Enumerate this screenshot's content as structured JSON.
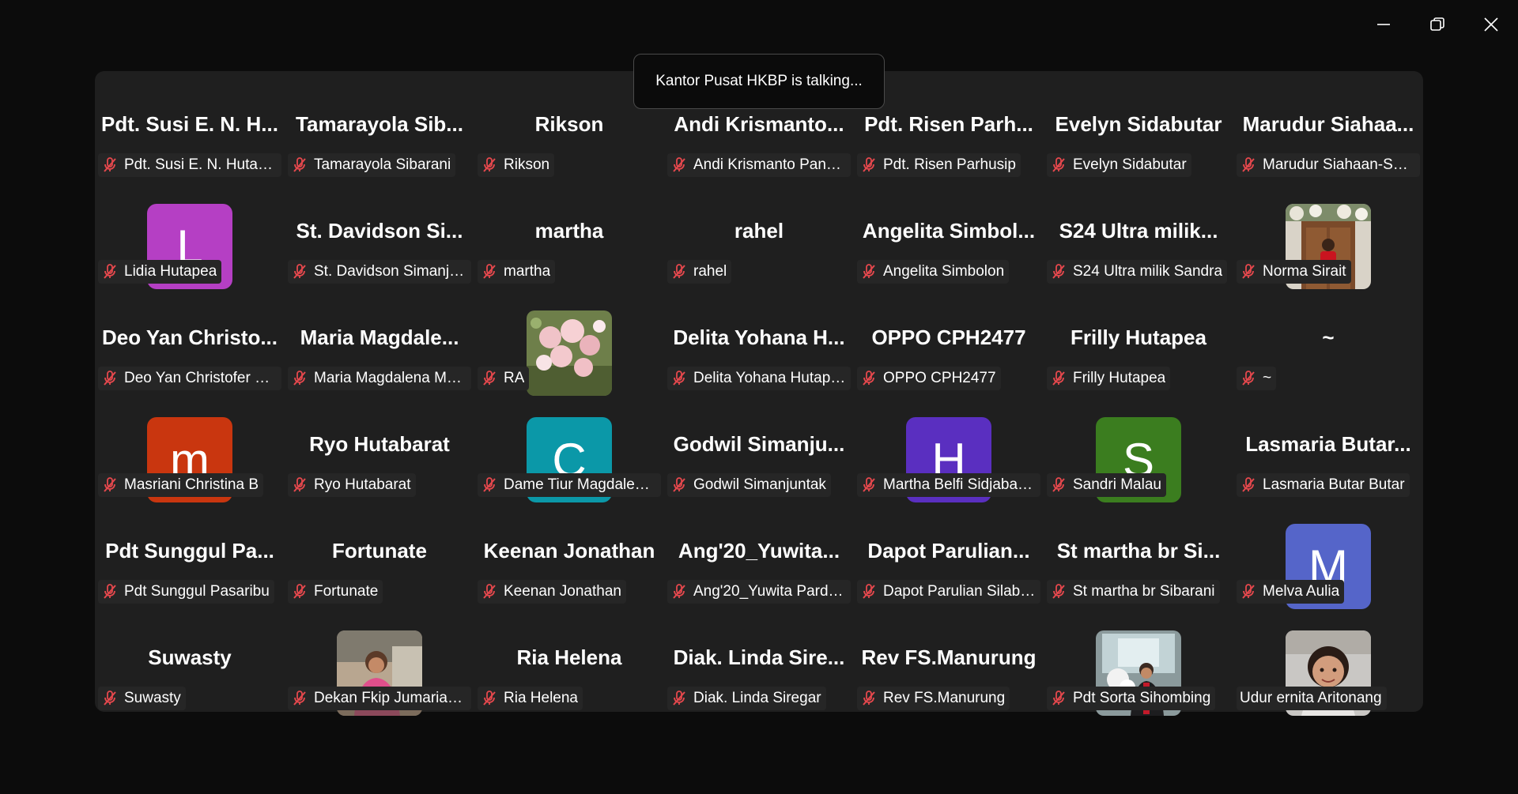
{
  "toast": {
    "text": "Kantor Pusat HKBP is talking..."
  },
  "window_controls": {
    "minimize_icon": "minimize-icon",
    "restore_icon": "restore-icon",
    "close_icon": "close-icon"
  },
  "colors": {
    "mic_muted": "#e5484d",
    "label_bg": "#262626",
    "gallery_bg": "#1f1f1f"
  },
  "participants": [
    {
      "display": "Pdt. Susi E. N. H...",
      "label": "Pdt. Susi E. N. Hutabar...",
      "muted": true
    },
    {
      "display": "Tamarayola  Sib...",
      "label": "Tamarayola Sibarani",
      "muted": true
    },
    {
      "display": "Rikson",
      "label": "Rikson",
      "muted": true
    },
    {
      "display": "Andi Krismanto...",
      "label": "Andi Krismanto Pangg...",
      "muted": true
    },
    {
      "display": "Pdt. Risen Parh...",
      "label": "Pdt. Risen Parhusip",
      "muted": true
    },
    {
      "display": "Evelyn Sidabutar",
      "label": "Evelyn Sidabutar",
      "muted": true
    },
    {
      "display": "Marudur  Siahaa...",
      "label": "Marudur Siahaan-STB ...",
      "muted": true
    },
    {
      "avatar": "L",
      "avatar_color": "#b53fc4",
      "label": "Lidia Hutapea",
      "muted": true
    },
    {
      "display": "St. Davidson Si...",
      "label": "St. Davidson Simanjun...",
      "muted": true
    },
    {
      "display": "martha",
      "label": "martha",
      "muted": true
    },
    {
      "display": "rahel",
      "label": "rahel",
      "muted": true
    },
    {
      "display": "Angelita  Simbol...",
      "label": "Angelita Simbolon",
      "muted": true
    },
    {
      "display": "S24 Ultra milik...",
      "label": "S24 Ultra milik Sandra",
      "muted": true
    },
    {
      "photo": "door-photo",
      "label": "Norma Sirait",
      "muted": true
    },
    {
      "display": "Deo Yan Christo...",
      "label": "Deo Yan Christofer Pa...",
      "muted": true
    },
    {
      "display": "Maria  Magdale...",
      "label": "Maria Magdalena Ma...",
      "muted": true
    },
    {
      "photo": "flowers-photo",
      "label": "RA",
      "muted": true
    },
    {
      "display": "Delita Yohana H...",
      "label": "Delita Yohana Hutapea",
      "muted": true
    },
    {
      "display": "OPPO CPH2477",
      "label": "OPPO CPH2477",
      "muted": true
    },
    {
      "display": "Frilly Hutapea",
      "label": "Frilly Hutapea",
      "muted": true
    },
    {
      "display": "~",
      "label": "~",
      "muted": true
    },
    {
      "avatar": "m",
      "avatar_color": "#c9360f",
      "label": "Masriani Christina B",
      "muted": true
    },
    {
      "display": "Ryo Hutabarat",
      "label": "Ryo Hutabarat",
      "muted": true
    },
    {
      "avatar": "C",
      "avatar_color": "#0b98a8",
      "label": "Dame Tiur Magdalena...",
      "muted": true
    },
    {
      "display": "Godwil  Simanju...",
      "label": "Godwil Simanjuntak",
      "muted": true
    },
    {
      "avatar": "H",
      "avatar_color": "#5a2fc0",
      "label": "Martha Belfi Sidjabat-...",
      "muted": true
    },
    {
      "avatar": "S",
      "avatar_color": "#3b7d1f",
      "label": "Sandri Malau",
      "muted": true
    },
    {
      "display": "Lasmaria  Butar...",
      "label": "Lasmaria Butar Butar",
      "muted": true
    },
    {
      "display": "Pdt Sunggul  Pa...",
      "label": "Pdt Sunggul Pasaribu",
      "muted": true
    },
    {
      "display": "Fortunate",
      "label": "Fortunate",
      "muted": true
    },
    {
      "display": "Keenan Jonathan",
      "label": "Keenan Jonathan",
      "muted": true
    },
    {
      "display": "Ang'20_Yuwita...",
      "label": "Ang'20_Yuwita Pardosi",
      "muted": true
    },
    {
      "display": "Dapot  Parulian...",
      "label": "Dapot Parulian Silaban",
      "muted": true
    },
    {
      "display": "St martha br Si...",
      "label": "St martha br Sibarani",
      "muted": true
    },
    {
      "avatar": "M",
      "avatar_color": "#5565c9",
      "label": "Melva Aulia",
      "muted": true
    },
    {
      "display": "Suwasty",
      "label": "Suwasty",
      "muted": true
    },
    {
      "photo": "woman-photo",
      "label": "Dekan Fkip Jumaria Sir...",
      "muted": true
    },
    {
      "display": "Ria Helena",
      "label": "Ria Helena",
      "muted": true
    },
    {
      "display": "Diak. Linda Sire...",
      "label": "Diak. Linda Siregar",
      "muted": true
    },
    {
      "display": "Rev FS.Manurung",
      "label": "Rev FS.Manurung",
      "muted": true
    },
    {
      "photo": "altar-photo",
      "label": "Pdt Sorta Sihombing",
      "muted": true
    },
    {
      "photo": "girl-photo",
      "label": "Udur ernita Aritonang",
      "muted": false
    }
  ]
}
